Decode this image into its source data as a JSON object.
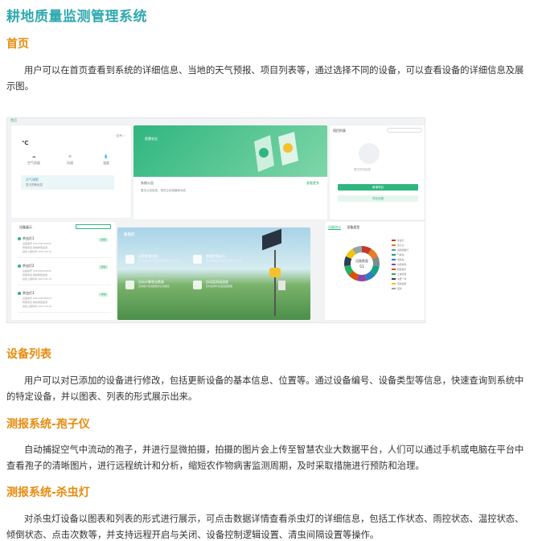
{
  "page": {
    "title": "耕地质量监测管理系统"
  },
  "sections": [
    {
      "heading": "首页",
      "text": "用户可以在首页查看到系统的详细信息、当地的天气预报、项目列表等，通过选择不同的设备，可以查看设备的详细信息及展示图。"
    },
    {
      "heading": "设备列表",
      "text": "用户可以对已添加的设备进行修改，包括更新设备的基本信息、位置等。通过设备编号、设备类型等信息，快速查询到系统中的特定设备，并以图表、列表的形式展示出来。"
    },
    {
      "heading": "测报系统-孢子仪",
      "text": "自动捕捉空气中流动的孢子，并进行显微拍摄，拍摄的图片会上传至智慧农业大数据平台，人们可以通过手机或电脑在平台中查看孢子的清晰图片，进行远程统计和分析，缩短农作物病害监测周期，及时采取措施进行预防和治理。"
    },
    {
      "heading": "测报系统-杀虫灯",
      "text": "对杀虫灯设备以图表和列表的形式进行展示，可点击数据详情查看杀虫灯的详细信息，包括工作状态、雨控状态、温控状态、倾倒状态、点击次数等，并支持远程开启与关闭、设备控制逻辑设置、清虫间隔设置等操作。"
    }
  ],
  "screenshot": {
    "crumb": "首页",
    "weather": {
      "temp": "℃",
      "location": "◦ 全州 ›",
      "items": [
        "空气质量",
        "风速",
        "湿度"
      ],
      "alert_title": "天气预警",
      "alert_text": "暂无预警信息"
    },
    "banner": {
      "title": "智慧农业",
      "notice": "系统公告",
      "more": "查看更多",
      "text": "暂无公告信息，请关注系统最新动态"
    },
    "project_list": {
      "title": "项目列表",
      "empty": "暂无项目信息",
      "primary_btn": "新增项目",
      "secondary_btn": "项目设置"
    },
    "device_list": {
      "title": "设备展示",
      "items": [
        {
          "name": "杀虫灯1",
          "l1": "设备编号 202304030041",
          "l2": "所属项目 耕地质量监测",
          "l3": "最新上报时间 2023-04-10",
          "btn": "详情"
        },
        {
          "name": "杀虫灯2",
          "l1": "设备编号 202304030042",
          "l2": "所属项目 耕地质量监测",
          "l3": "最新上报时间 2023-04-10",
          "btn": "详情"
        },
        {
          "name": "杀虫灯3",
          "l1": "设备编号 202304030043",
          "l2": "所属项目 耕地质量监测",
          "l3": "最新上报时间 2023-04-10",
          "btn": "详情"
        }
      ]
    },
    "insect_lamp": {
      "title": "杀虫灯",
      "features": [
        {
          "title": "远程查看设备",
          "desc": "通过电脑或手机远程查看设备运行状态"
        },
        {
          "title": "批量控制运行",
          "desc": "通过电脑或手机批量控制设备运行"
        },
        {
          "title": "自动计算害虫数量",
          "desc": "自动统计杀虫数量并生成报表"
        },
        {
          "title": "自动监测温湿度",
          "desc": "实时监测环境温湿度数据"
        }
      ]
    },
    "stats": {
      "tab1": "设备统计",
      "tab2": "设备类型",
      "center_label": "设备数量",
      "center_value": "51",
      "legend": [
        "杀虫灯",
        "孢子仪",
        "虫情测报灯",
        "气象站",
        "墒情站",
        "水质监测",
        "视频监控",
        "土壤检测",
        "水肥一体",
        "苗情监测",
        "其他"
      ],
      "colors": [
        "#c0392b",
        "#e67e22",
        "#7f8c8d",
        "#16a085",
        "#2980b9",
        "#8e44ad",
        "#d35400",
        "#27ae60",
        "#2c3e50",
        "#f1c40f",
        "#95a5a6"
      ]
    }
  }
}
